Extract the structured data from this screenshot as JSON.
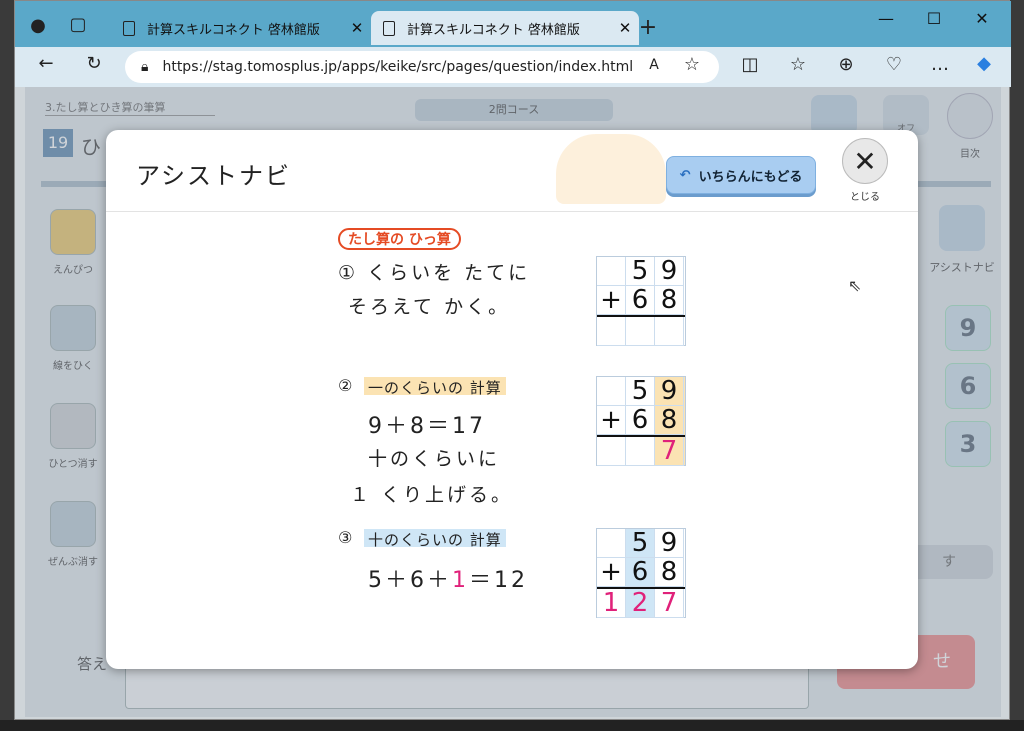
{
  "browser": {
    "tabs": [
      {
        "title": "計算スキルコネクト 啓林館版"
      },
      {
        "title": "計算スキルコネクト 啓林館版"
      }
    ],
    "url": "https://stag.tomosplus.jp/apps/keike/src/pages/question/index.html"
  },
  "page": {
    "breadcrumb": "3.たし算とひき算の筆算",
    "course": "2問コース",
    "problem_number": "19",
    "problem_title_fragment": "ひ",
    "tools": [
      {
        "label": "えんぴつ"
      },
      {
        "label": "線をひく"
      },
      {
        "label": "ひとつ消す"
      },
      {
        "label": "ぜんぶ消す"
      }
    ],
    "right_tools": {
      "assist": "アシストナビ",
      "contents": "目次",
      "off": "オフ"
    },
    "number_keys": [
      "9",
      "6",
      "3"
    ],
    "answer_label": "答え",
    "erase_btn": "す",
    "submit_btn": "せ"
  },
  "modal": {
    "title": "アシストナビ",
    "back_button": "いちらんにもどる",
    "close_label": "とじる",
    "badge": "たし算の ひっ算",
    "step1_line1": "① くらいを たてに",
    "step1_line2": "そろえて かく。",
    "step2_header": "一のくらいの 計算",
    "step2_eq": "9＋8＝17",
    "step2_line2": "十のくらいに",
    "step2_line3": "１ くり上げる。",
    "step3_header": "十のくらいの 計算",
    "step3_eq_a": "5＋6＋",
    "step3_eq_b": "1",
    "step3_eq_c": "＝12",
    "grid1": {
      "top": [
        "",
        "5",
        "9"
      ],
      "mid": [
        "+",
        "6",
        "8"
      ],
      "bot": [
        "",
        "",
        ""
      ]
    },
    "grid2": {
      "top": [
        "",
        "5",
        "9"
      ],
      "mid": [
        "+",
        "6",
        "8"
      ],
      "bot": [
        "",
        "",
        "7"
      ]
    },
    "grid3": {
      "top": [
        "",
        "5",
        "9"
      ],
      "mid": [
        "+",
        "6",
        "8"
      ],
      "bot": [
        "1",
        "2",
        "7"
      ]
    }
  }
}
